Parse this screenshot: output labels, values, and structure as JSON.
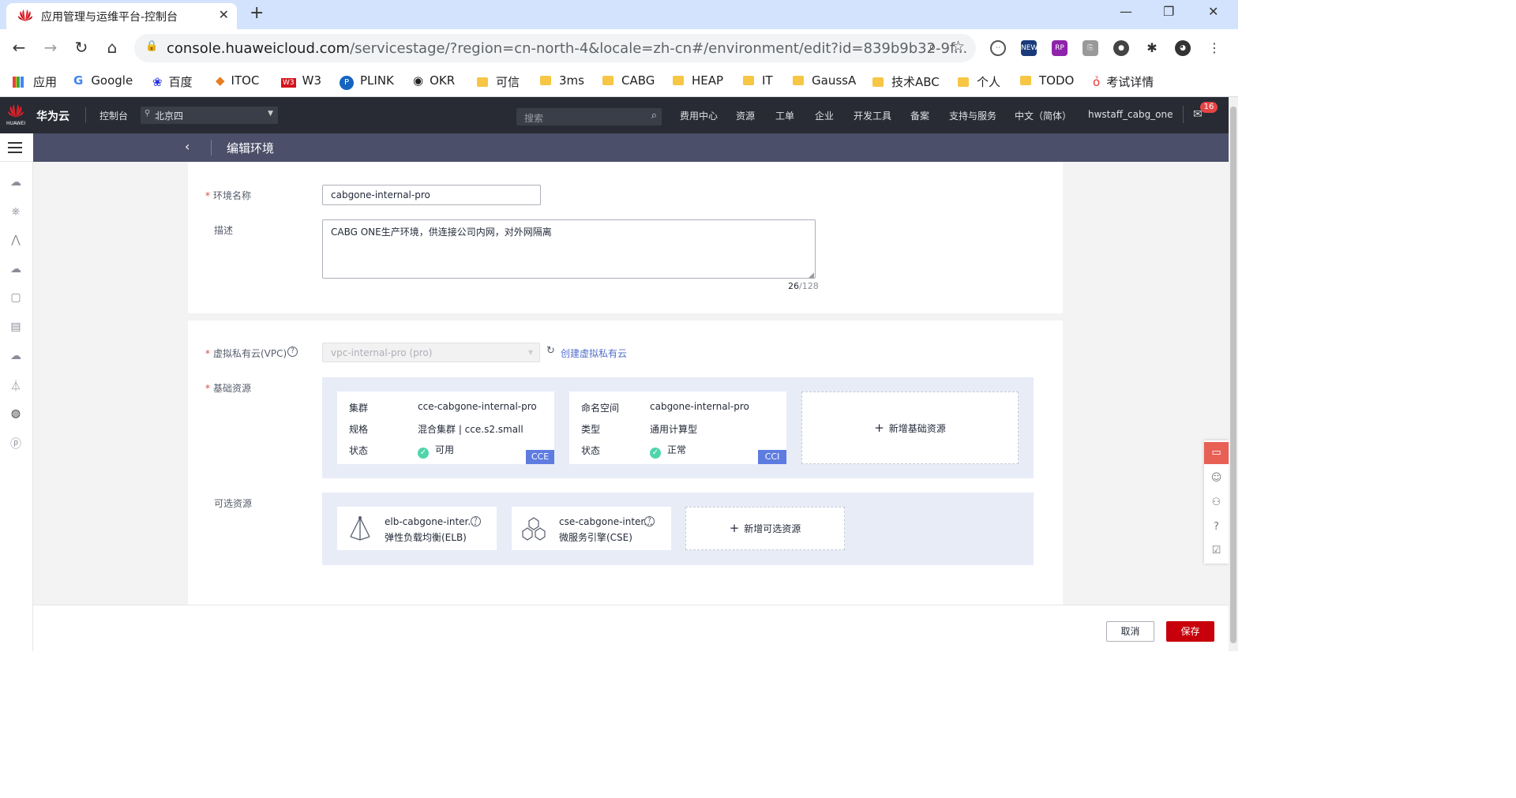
{
  "browser": {
    "tab_title": "应用管理与运维平台-控制台",
    "new_tab": "+",
    "url_host": "console.huaweicloud.com",
    "url_path": "/servicestage/?region=cn-north-4&locale=zh-cn#/environment/edit?id=839b9b32-9f...",
    "bookmarks": [
      "应用",
      "Google",
      "百度",
      "ITOC",
      "W3",
      "PLINK",
      "OKR",
      "可信",
      "3ms",
      "CABG",
      "HEAP",
      "IT",
      "GaussA",
      "技术ABC",
      "个人",
      "TODO",
      "考试详情"
    ]
  },
  "topnav": {
    "logo_text": "HUAWEI",
    "brand": "华为云",
    "console": "控制台",
    "region": "北京四",
    "search_placeholder": "搜索",
    "items": [
      "费用中心",
      "资源",
      "工单",
      "企业",
      "开发工具",
      "备案",
      "支持与服务",
      "中文（简体）"
    ],
    "username": "hwstaff_cabg_one",
    "mail_badge": "16"
  },
  "page": {
    "title": "编辑环境"
  },
  "form": {
    "name_label": "环境名称",
    "name_value": "cabgone-internal-pro",
    "desc_label": "描述",
    "desc_value": "CABG ONE生产环境，供连接公司内网，对外网隔离",
    "desc_count": "26",
    "desc_max": "/128",
    "vpc_label": "虚拟私有云(VPC)",
    "vpc_value": "vpc-internal-pro (pro)",
    "vpc_create": "创建虚拟私有云",
    "base_label": "基础资源",
    "optional_label": "可选资源"
  },
  "base_resources": [
    {
      "k1": "集群",
      "v1": "cce-cabgone-internal-pro",
      "k2": "规格",
      "v2": "混合集群 | cce.s2.small",
      "k3": "状态",
      "v3": "可用",
      "tag": "CCE"
    },
    {
      "k1": "命名空间",
      "v1": "cabgone-internal-pro",
      "k2": "类型",
      "v2": "通用计算型",
      "k3": "状态",
      "v3": "正常",
      "tag": "CCI"
    }
  ],
  "add_base": "新增基础资源",
  "optional_resources": [
    {
      "name": "elb-cabgone-inter...",
      "type": "弹性负载均衡(ELB)"
    },
    {
      "name": "cse-cabgone-inter...",
      "type": "微服务引擎(CSE)"
    }
  ],
  "add_optional": "新增可选资源",
  "footer": {
    "cancel": "取消",
    "save": "保存"
  },
  "colors": {
    "accent": "#c7000b",
    "link": "#526ecc",
    "topnav": "#282b33",
    "subnav": "#4b4f69"
  }
}
